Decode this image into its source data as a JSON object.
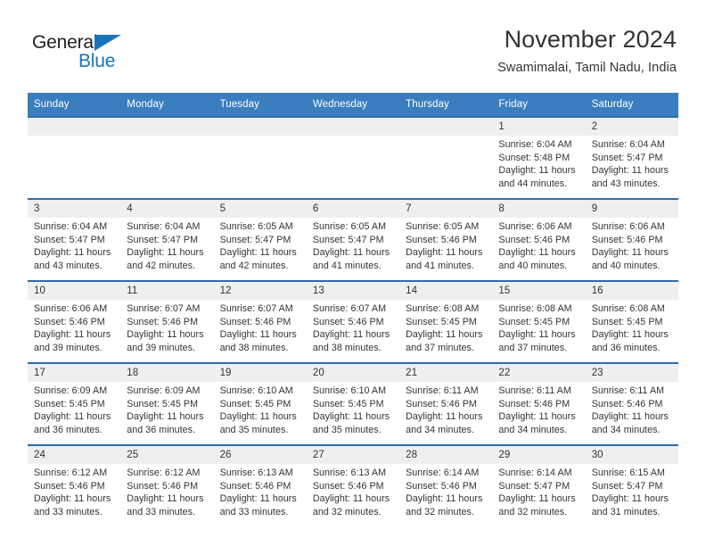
{
  "brand": {
    "name_top": "General",
    "name_bottom": "Blue",
    "triangle_color": "#1b74ba",
    "text_color": "#231f20"
  },
  "header": {
    "title": "November 2024",
    "subtitle": "Swamimalai, Tamil Nadu, India"
  },
  "theme": {
    "header_row_bg": "#3a7ebf",
    "cell_top_border": "#2e6da4",
    "daynum_bg": "#efefef",
    "text": "#333333"
  },
  "weekdays": [
    "Sunday",
    "Monday",
    "Tuesday",
    "Wednesday",
    "Thursday",
    "Friday",
    "Saturday"
  ],
  "labels": {
    "sunrise": "Sunrise:",
    "sunset": "Sunset:",
    "daylight": "Daylight:"
  },
  "weeks": [
    [
      {
        "empty": true
      },
      {
        "empty": true
      },
      {
        "empty": true
      },
      {
        "empty": true
      },
      {
        "empty": true
      },
      {
        "day": "1",
        "sunrise": "Sunrise: 6:04 AM",
        "sunset": "Sunset: 5:48 PM",
        "daylight": "Daylight: 11 hours and 44 minutes."
      },
      {
        "day": "2",
        "sunrise": "Sunrise: 6:04 AM",
        "sunset": "Sunset: 5:47 PM",
        "daylight": "Daylight: 11 hours and 43 minutes."
      }
    ],
    [
      {
        "day": "3",
        "sunrise": "Sunrise: 6:04 AM",
        "sunset": "Sunset: 5:47 PM",
        "daylight": "Daylight: 11 hours and 43 minutes."
      },
      {
        "day": "4",
        "sunrise": "Sunrise: 6:04 AM",
        "sunset": "Sunset: 5:47 PM",
        "daylight": "Daylight: 11 hours and 42 minutes."
      },
      {
        "day": "5",
        "sunrise": "Sunrise: 6:05 AM",
        "sunset": "Sunset: 5:47 PM",
        "daylight": "Daylight: 11 hours and 42 minutes."
      },
      {
        "day": "6",
        "sunrise": "Sunrise: 6:05 AM",
        "sunset": "Sunset: 5:47 PM",
        "daylight": "Daylight: 11 hours and 41 minutes."
      },
      {
        "day": "7",
        "sunrise": "Sunrise: 6:05 AM",
        "sunset": "Sunset: 5:46 PM",
        "daylight": "Daylight: 11 hours and 41 minutes."
      },
      {
        "day": "8",
        "sunrise": "Sunrise: 6:06 AM",
        "sunset": "Sunset: 5:46 PM",
        "daylight": "Daylight: 11 hours and 40 minutes."
      },
      {
        "day": "9",
        "sunrise": "Sunrise: 6:06 AM",
        "sunset": "Sunset: 5:46 PM",
        "daylight": "Daylight: 11 hours and 40 minutes."
      }
    ],
    [
      {
        "day": "10",
        "sunrise": "Sunrise: 6:06 AM",
        "sunset": "Sunset: 5:46 PM",
        "daylight": "Daylight: 11 hours and 39 minutes."
      },
      {
        "day": "11",
        "sunrise": "Sunrise: 6:07 AM",
        "sunset": "Sunset: 5:46 PM",
        "daylight": "Daylight: 11 hours and 39 minutes."
      },
      {
        "day": "12",
        "sunrise": "Sunrise: 6:07 AM",
        "sunset": "Sunset: 5:46 PM",
        "daylight": "Daylight: 11 hours and 38 minutes."
      },
      {
        "day": "13",
        "sunrise": "Sunrise: 6:07 AM",
        "sunset": "Sunset: 5:46 PM",
        "daylight": "Daylight: 11 hours and 38 minutes."
      },
      {
        "day": "14",
        "sunrise": "Sunrise: 6:08 AM",
        "sunset": "Sunset: 5:45 PM",
        "daylight": "Daylight: 11 hours and 37 minutes."
      },
      {
        "day": "15",
        "sunrise": "Sunrise: 6:08 AM",
        "sunset": "Sunset: 5:45 PM",
        "daylight": "Daylight: 11 hours and 37 minutes."
      },
      {
        "day": "16",
        "sunrise": "Sunrise: 6:08 AM",
        "sunset": "Sunset: 5:45 PM",
        "daylight": "Daylight: 11 hours and 36 minutes."
      }
    ],
    [
      {
        "day": "17",
        "sunrise": "Sunrise: 6:09 AM",
        "sunset": "Sunset: 5:45 PM",
        "daylight": "Daylight: 11 hours and 36 minutes."
      },
      {
        "day": "18",
        "sunrise": "Sunrise: 6:09 AM",
        "sunset": "Sunset: 5:45 PM",
        "daylight": "Daylight: 11 hours and 36 minutes."
      },
      {
        "day": "19",
        "sunrise": "Sunrise: 6:10 AM",
        "sunset": "Sunset: 5:45 PM",
        "daylight": "Daylight: 11 hours and 35 minutes."
      },
      {
        "day": "20",
        "sunrise": "Sunrise: 6:10 AM",
        "sunset": "Sunset: 5:45 PM",
        "daylight": "Daylight: 11 hours and 35 minutes."
      },
      {
        "day": "21",
        "sunrise": "Sunrise: 6:11 AM",
        "sunset": "Sunset: 5:46 PM",
        "daylight": "Daylight: 11 hours and 34 minutes."
      },
      {
        "day": "22",
        "sunrise": "Sunrise: 6:11 AM",
        "sunset": "Sunset: 5:46 PM",
        "daylight": "Daylight: 11 hours and 34 minutes."
      },
      {
        "day": "23",
        "sunrise": "Sunrise: 6:11 AM",
        "sunset": "Sunset: 5:46 PM",
        "daylight": "Daylight: 11 hours and 34 minutes."
      }
    ],
    [
      {
        "day": "24",
        "sunrise": "Sunrise: 6:12 AM",
        "sunset": "Sunset: 5:46 PM",
        "daylight": "Daylight: 11 hours and 33 minutes."
      },
      {
        "day": "25",
        "sunrise": "Sunrise: 6:12 AM",
        "sunset": "Sunset: 5:46 PM",
        "daylight": "Daylight: 11 hours and 33 minutes."
      },
      {
        "day": "26",
        "sunrise": "Sunrise: 6:13 AM",
        "sunset": "Sunset: 5:46 PM",
        "daylight": "Daylight: 11 hours and 33 minutes."
      },
      {
        "day": "27",
        "sunrise": "Sunrise: 6:13 AM",
        "sunset": "Sunset: 5:46 PM",
        "daylight": "Daylight: 11 hours and 32 minutes."
      },
      {
        "day": "28",
        "sunrise": "Sunrise: 6:14 AM",
        "sunset": "Sunset: 5:46 PM",
        "daylight": "Daylight: 11 hours and 32 minutes."
      },
      {
        "day": "29",
        "sunrise": "Sunrise: 6:14 AM",
        "sunset": "Sunset: 5:47 PM",
        "daylight": "Daylight: 11 hours and 32 minutes."
      },
      {
        "day": "30",
        "sunrise": "Sunrise: 6:15 AM",
        "sunset": "Sunset: 5:47 PM",
        "daylight": "Daylight: 11 hours and 31 minutes."
      }
    ]
  ]
}
